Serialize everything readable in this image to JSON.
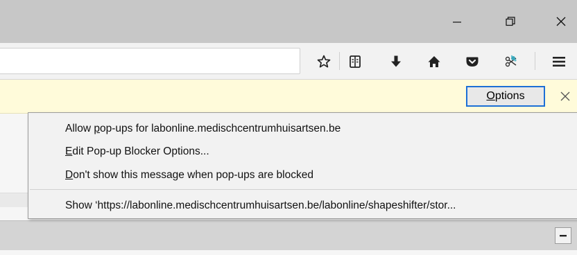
{
  "window": {
    "minimize_label": "Minimize",
    "restore_label": "Restore",
    "close_label": "Close"
  },
  "toolbar": {
    "icons": [
      "bookmark-star-icon",
      "reading-list-icon",
      "download-icon",
      "home-icon",
      "pocket-icon",
      "extension-icon",
      "hamburger-menu-icon"
    ]
  },
  "notification": {
    "options_label_accesskey": "O",
    "options_label_rest": "ptions"
  },
  "popup_menu": {
    "items": [
      {
        "pre": "Allow ",
        "accesskey": "p",
        "post": "op-ups for labonline.medischcentrumhuisartsen.be"
      },
      {
        "pre": "",
        "accesskey": "E",
        "post": "dit Pop-up Blocker Options..."
      },
      {
        "pre": "",
        "accesskey": "D",
        "post": "on't show this message when pop-ups are blocked"
      },
      {
        "pre": "",
        "accesskey": "",
        "post": "Show ‘https://labonline.medischcentrumhuisartsen.be/labonline/shapeshifter/stor..."
      }
    ]
  },
  "colors": {
    "notification_bg": "#fffbda",
    "focus_border": "#1c6fd6",
    "titlebar_bg": "#c7c7c7"
  }
}
